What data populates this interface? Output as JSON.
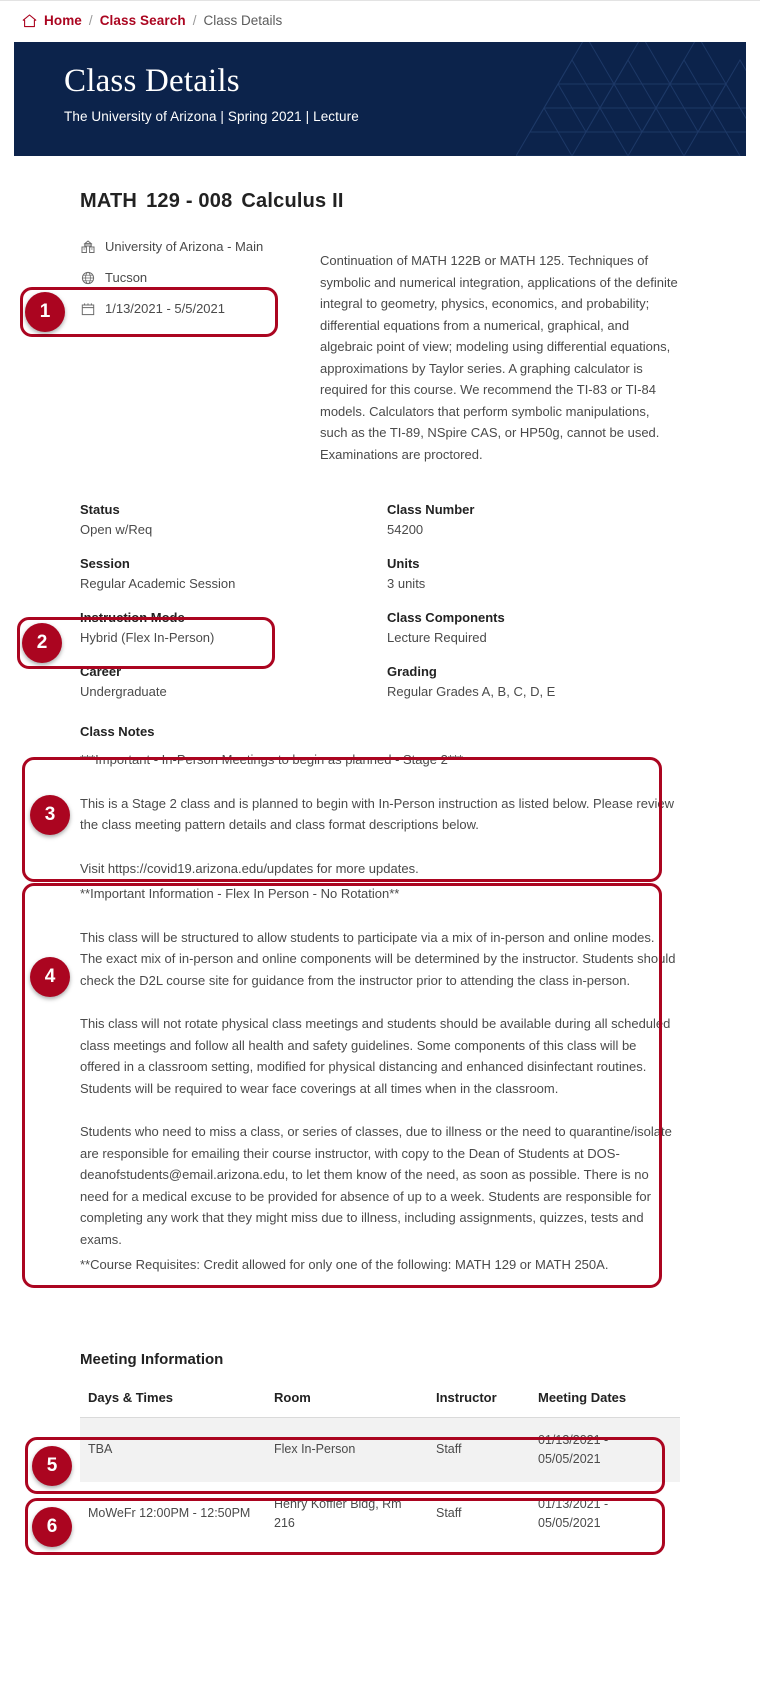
{
  "breadcrumb": {
    "home_icon": "home-icon",
    "items": [
      {
        "label": "Home",
        "type": "link"
      },
      {
        "label": "Class Search",
        "type": "link"
      },
      {
        "label": "Class Details",
        "type": "current"
      }
    ],
    "separator": "/"
  },
  "hero": {
    "title": "Class Details",
    "subtitle": "The University of Arizona | Spring 2021 | Lecture"
  },
  "course": {
    "subject": "MATH",
    "number": "129 - 008",
    "name": "Calculus II",
    "meta": [
      {
        "icon": "campus-icon",
        "label": "University of Arizona - Main"
      },
      {
        "icon": "globe-icon",
        "label": "Tucson"
      },
      {
        "icon": "calendar-icon",
        "label": "1/13/2021 - 5/5/2021"
      }
    ],
    "description": "Continuation of MATH 122B or MATH 125. Techniques of symbolic and numerical integration, applications of the definite integral to geometry, physics, economics, and probability; differential equations from a numerical, graphical, and algebraic point of view; modeling using differential equations, approximations by Taylor series. A graphing calculator is required for this course.  We recommend the TI-83 or TI-84 models. Calculators that perform symbolic manipulations, such as the TI-89, NSpire CAS, or HP50g, cannot be used. Examinations are proctored."
  },
  "fields": [
    [
      {
        "label": "Status",
        "value": "Open w/Req"
      },
      {
        "label": "Class Number",
        "value": "54200"
      }
    ],
    [
      {
        "label": "Session",
        "value": "Regular Academic Session"
      },
      {
        "label": "Units",
        "value": "3 units"
      }
    ],
    [
      {
        "label": "Instruction Mode",
        "value": "Hybrid (Flex In-Person)"
      },
      {
        "label": "Class Components",
        "value": "Lecture Required"
      }
    ],
    [
      {
        "label": "Career",
        "value": "Undergraduate"
      },
      {
        "label": "Grading",
        "value": "Regular Grades A, B, C, D, E"
      }
    ]
  ],
  "class_notes": {
    "heading": "Class Notes",
    "stage_header": "***Important - In-Person Meetings to begin as planned - Stage 2***",
    "stage_para": "This is a Stage 2 class and is planned to begin with In-Person instruction as listed below. Please review the class meeting pattern details and class format descriptions below.",
    "visit_line": "Visit https://covid19.arizona.edu/updates for more updates.",
    "flex_header": "**Important Information - Flex In Person - No Rotation**",
    "flex_para_1": "This class will be structured to allow students to participate via a mix of in-person and online modes. The exact mix of in-person and online components will be determined by the instructor. Students should check the D2L course site for guidance from the instructor prior to attending the class in-person.",
    "flex_para_2": "This class will not rotate physical class meetings and students should be available during all scheduled class meetings and follow all health and safety guidelines. Some components of this class will be offered in a classroom setting, modified for physical distancing and enhanced disinfectant routines.  Students will be required to wear face coverings at all times when in the classroom.",
    "flex_para_3": "Students who need to miss a class, or series of classes, due to illness or the need to quarantine/isolate are responsible for emailing their course instructor, with copy to the Dean of Students at DOS-deanofstudents@email.arizona.edu, to let them know of the need, as soon as possible. There is no need for a medical excuse to be provided for absence of up to a week. Students are responsible for completing any work that they might miss due to illness, including assignments, quizzes, tests and exams.",
    "requisites": "**Course Requisites: Credit allowed for only one of the following: MATH 129 or MATH 250A."
  },
  "meeting": {
    "heading": "Meeting Information",
    "columns": [
      "Days & Times",
      "Room",
      "Instructor",
      "Meeting Dates"
    ],
    "rows": [
      {
        "days_times": "TBA",
        "room": "Flex In-Person",
        "instructor": "Staff",
        "dates": "01/13/2021 - 05/05/2021"
      },
      {
        "days_times": "MoWeFr 12:00PM - 12:50PM",
        "room": "Henry Koffler Bldg, Rm 216",
        "instructor": "Staff",
        "dates": "01/13/2021 - 05/05/2021"
      }
    ]
  },
  "annotations": [
    {
      "number": "1"
    },
    {
      "number": "2"
    },
    {
      "number": "3"
    },
    {
      "number": "4"
    },
    {
      "number": "5"
    },
    {
      "number": "6"
    }
  ],
  "colors": {
    "brand_red": "#AB0520",
    "brand_navy": "#0C234B",
    "text": "#4a4a4a"
  }
}
